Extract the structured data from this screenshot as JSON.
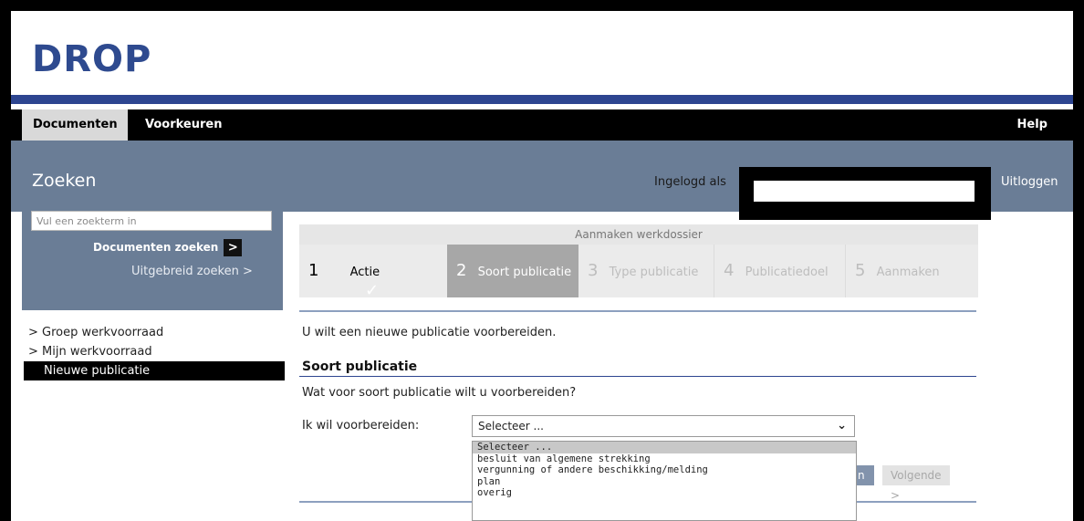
{
  "app": {
    "logo": "DROP"
  },
  "topnav": {
    "tabs": [
      {
        "label": "Documenten",
        "active": true
      },
      {
        "label": "Voorkeuren",
        "active": false
      }
    ],
    "help": "Help"
  },
  "header": {
    "section_title": "Zoeken",
    "logged_in_label": "Ingelogd als",
    "logout": "Uitloggen"
  },
  "search": {
    "placeholder": "Vul een zoekterm in",
    "docs_search_label": "Documenten zoeken",
    "docs_search_arrow": ">",
    "advanced_label": "Uitgebreid zoeken >"
  },
  "sidebar": {
    "items": [
      {
        "label": "> Groep werkvoorraad"
      },
      {
        "label": "> Mijn werkvoorraad"
      },
      {
        "label": "Nieuwe publicatie",
        "active": true
      }
    ]
  },
  "wizard": {
    "title": "Aanmaken werkdossier",
    "steps": [
      {
        "num": "1",
        "label": "Actie",
        "state": "done"
      },
      {
        "num": "2",
        "label": "Soort publicatie",
        "state": "current"
      },
      {
        "num": "3",
        "label": "Type publicatie",
        "state": "future"
      },
      {
        "num": "4",
        "label": "Publicatiedoel",
        "state": "future"
      },
      {
        "num": "5",
        "label": "Aanmaken",
        "state": "future"
      }
    ],
    "check_icon": "✓"
  },
  "main": {
    "intro": "U wilt een nieuwe publicatie voorbereiden.",
    "subheading": "Soort publicatie",
    "question": "Wat voor soort publicatie wilt u voorbereiden?",
    "field_label": "Ik wil voorbereiden:",
    "select_value": "Selecteer ...",
    "options": [
      "Selecteer ...",
      "besluit van algemene strekking",
      "vergunning of andere beschikking/melding",
      "plan",
      "overig"
    ],
    "back_button": "n",
    "next_button": "Volgende >"
  },
  "colors": {
    "brand_blue": "#2e4a8f",
    "header_band": "#6a7d96",
    "current_step": "#a7a7a7"
  }
}
